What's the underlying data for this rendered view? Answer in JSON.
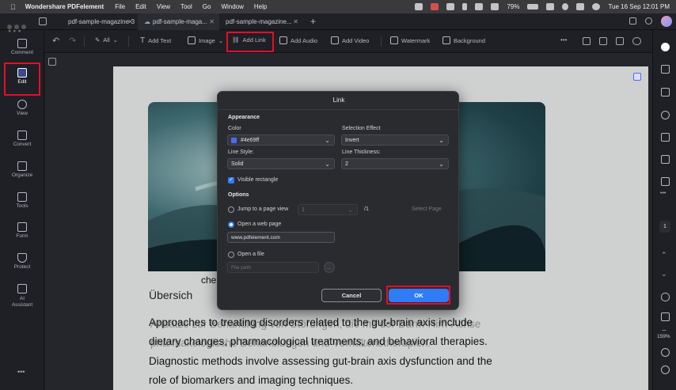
{
  "menubar": {
    "app": "Wondershare PDFelement",
    "items": [
      "File",
      "Edit",
      "View",
      "Tool",
      "Go",
      "Window",
      "Help"
    ],
    "battery": "79%",
    "datetime": "Tue 16 Sep  12:01 PM"
  },
  "tabs": [
    {
      "label": "pdf-sample-magazine-3",
      "active": false
    },
    {
      "label": "pdf-sample-maga...",
      "active": true
    },
    {
      "label": "pdf-sample-magazine...",
      "active": false
    }
  ],
  "sidebar": {
    "items": [
      {
        "label": "Comment"
      },
      {
        "label": "Edit"
      },
      {
        "label": "View"
      },
      {
        "label": "Convert"
      },
      {
        "label": "Organize"
      },
      {
        "label": "Tools"
      },
      {
        "label": "Form"
      },
      {
        "label": "Protect"
      },
      {
        "label": "AI\nAssistant"
      }
    ]
  },
  "toolbar": {
    "all": "All",
    "add_text": "Add Text",
    "image": "Image",
    "add_link": "Add Link",
    "add_audio": "Add Audio",
    "add_video": "Add Video",
    "watermark": "Watermark",
    "background": "Background"
  },
  "document": {
    "frag_che": "che",
    "heading": "Übersich",
    "lines": [
      "Approaches to treating disorders related to the gut-brain axis include",
      "dietary changes, pharmacological treatments, and behavioral therapies.",
      "Diagnostic methods involve assessing gut-brain axis dysfunction and the",
      "role of biomarkers and imaging techniques."
    ]
  },
  "dialog": {
    "title": "Link",
    "appearance": "Appearance",
    "color_label": "Color",
    "color_value": "#4e69ff",
    "selection_effect_label": "Selection Effect",
    "selection_effect_value": "Invert",
    "line_style_label": "Line Style:",
    "line_style_value": "Solid",
    "line_thickness_label": "Line Thickness:",
    "line_thickness_value": "2",
    "visible_rect": "Visible rectangle",
    "options": "Options",
    "jump_label": "Jump to a page view",
    "jump_page": "1",
    "jump_total": "/1",
    "select_page": "Select Page",
    "web_label": "Open a web page",
    "web_value": "www.pdfelement.com",
    "file_label": "Open a file",
    "file_placeholder": "File path",
    "file_browse": "...",
    "cancel": "Cancel",
    "ok": "OK"
  },
  "rightbar": {
    "page_num": "1",
    "zoom": "159%"
  },
  "colors": {
    "accent": "#2f7cf6",
    "highlight": "#e0102a",
    "link_color": "#4e69ff"
  }
}
